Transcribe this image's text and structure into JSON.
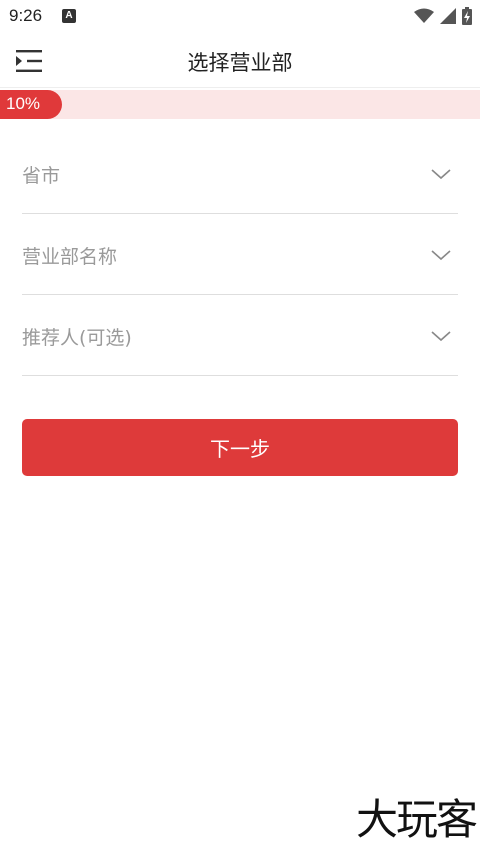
{
  "status_bar": {
    "time": "9:26",
    "notification_badge": "A",
    "icons": [
      "wifi-icon",
      "cell-signal-icon",
      "battery-charging-icon"
    ]
  },
  "header": {
    "title": "选择营业部",
    "menu_icon": "menu-collapse-icon"
  },
  "progress": {
    "label": "10%",
    "value": 0.1,
    "fill_color": "#e0393a",
    "track_color": "#fbe6e6"
  },
  "form": {
    "fields": [
      {
        "placeholder": "省市",
        "icon": "chevron-down-icon"
      },
      {
        "placeholder": "营业部名称",
        "icon": "chevron-down-icon"
      },
      {
        "placeholder": "推荐人(可选)",
        "icon": "chevron-down-icon"
      }
    ]
  },
  "actions": {
    "next_label": "下一步",
    "accent_color": "#de3a3a"
  },
  "watermark": {
    "text": "大玩客"
  }
}
